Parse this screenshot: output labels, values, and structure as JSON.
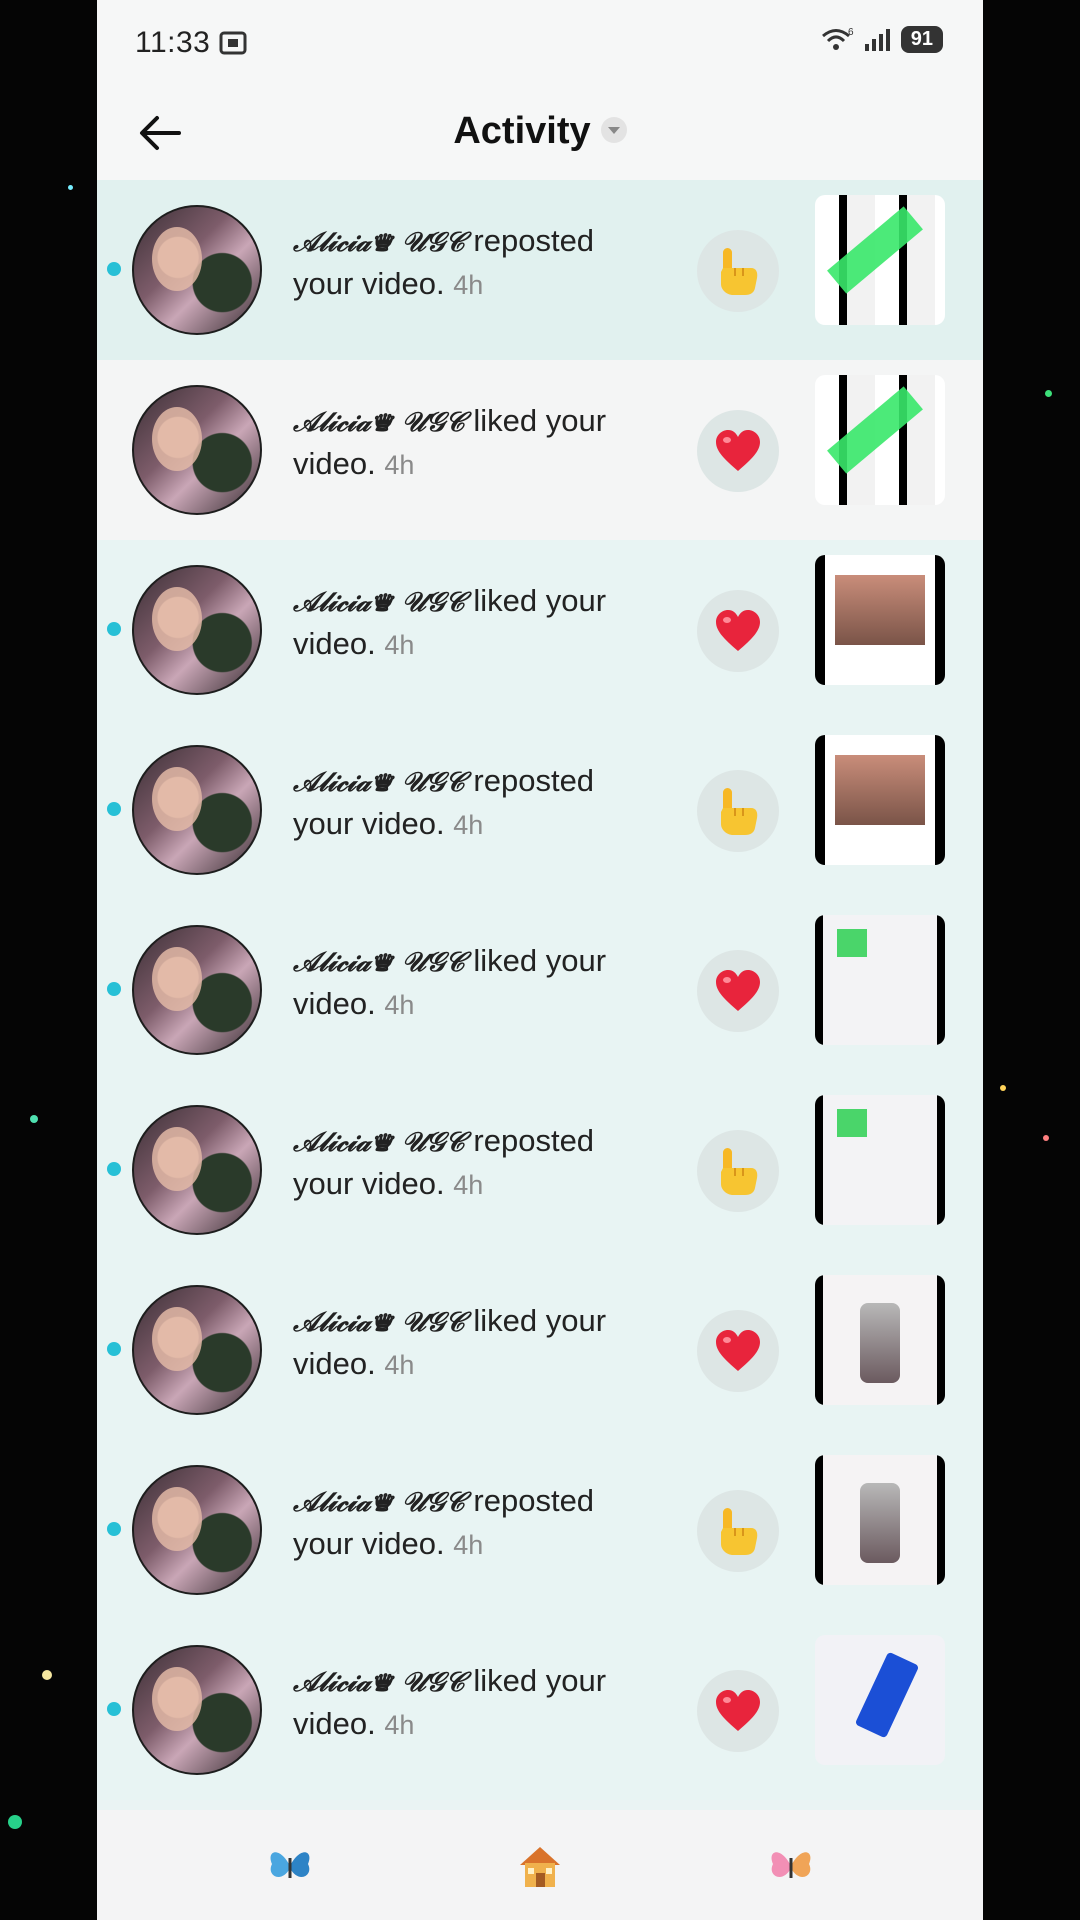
{
  "status_bar": {
    "time": "11:33",
    "battery": "91",
    "network": "6"
  },
  "header": {
    "title": "Activity"
  },
  "activities": [
    {
      "user": "𝒜𝓁𝒾𝒸𝒾𝒶♛ 𝒰𝒢𝒞",
      "action": "reposted your video.",
      "time": "4h",
      "type": "repost",
      "unread": true,
      "thumb": "t1"
    },
    {
      "user": "𝒜𝓁𝒾𝒸𝒾𝒶♛ 𝒰𝒢𝒞",
      "action": "liked your video.",
      "time": "4h",
      "type": "like",
      "unread": false,
      "thumb": "t1"
    },
    {
      "user": "𝒜𝓁𝒾𝒸𝒾𝒶♛ 𝒰𝒢𝒞",
      "action": "liked your video.",
      "time": "4h",
      "type": "like",
      "unread": true,
      "thumb": "t2"
    },
    {
      "user": "𝒜𝓁𝒾𝒸𝒾𝒶♛ 𝒰𝒢𝒞",
      "action": "reposted your video.",
      "time": "4h",
      "type": "repost",
      "unread": true,
      "thumb": "t2"
    },
    {
      "user": "𝒜𝓁𝒾𝒸𝒾𝒶♛ 𝒰𝒢𝒞",
      "action": "liked your video.",
      "time": "4h",
      "type": "like",
      "unread": true,
      "thumb": "t3"
    },
    {
      "user": "𝒜𝓁𝒾𝒸𝒾𝒶♛ 𝒰𝒢𝒞",
      "action": "reposted your video.",
      "time": "4h",
      "type": "repost",
      "unread": true,
      "thumb": "t3"
    },
    {
      "user": "𝒜𝓁𝒾𝒸𝒾𝒶♛ 𝒰𝒢𝒞",
      "action": "liked your video.",
      "time": "4h",
      "type": "like",
      "unread": true,
      "thumb": "t4"
    },
    {
      "user": "𝒜𝓁𝒾𝒸𝒾𝒶♛ 𝒰𝒢𝒞",
      "action": "reposted your video.",
      "time": "4h",
      "type": "repost",
      "unread": true,
      "thumb": "t4"
    },
    {
      "user": "𝒜𝓁𝒾𝒸𝒾𝒶♛ 𝒰𝒢𝒞",
      "action": "liked your video.",
      "time": "4h",
      "type": "like",
      "unread": true,
      "thumb": "t5"
    }
  ],
  "icons": {
    "back": "back-arrow-icon",
    "like": "heart-icon",
    "repost": "pointing-hand-icon",
    "nav": [
      "butterfly-icon",
      "house-icon",
      "butterfly-icon"
    ]
  },
  "colors": {
    "unread_dot": "#27c0d6",
    "heart": "#e8243c",
    "row_unread": "#e8f4f3",
    "row_read": "#f4f5f5"
  }
}
